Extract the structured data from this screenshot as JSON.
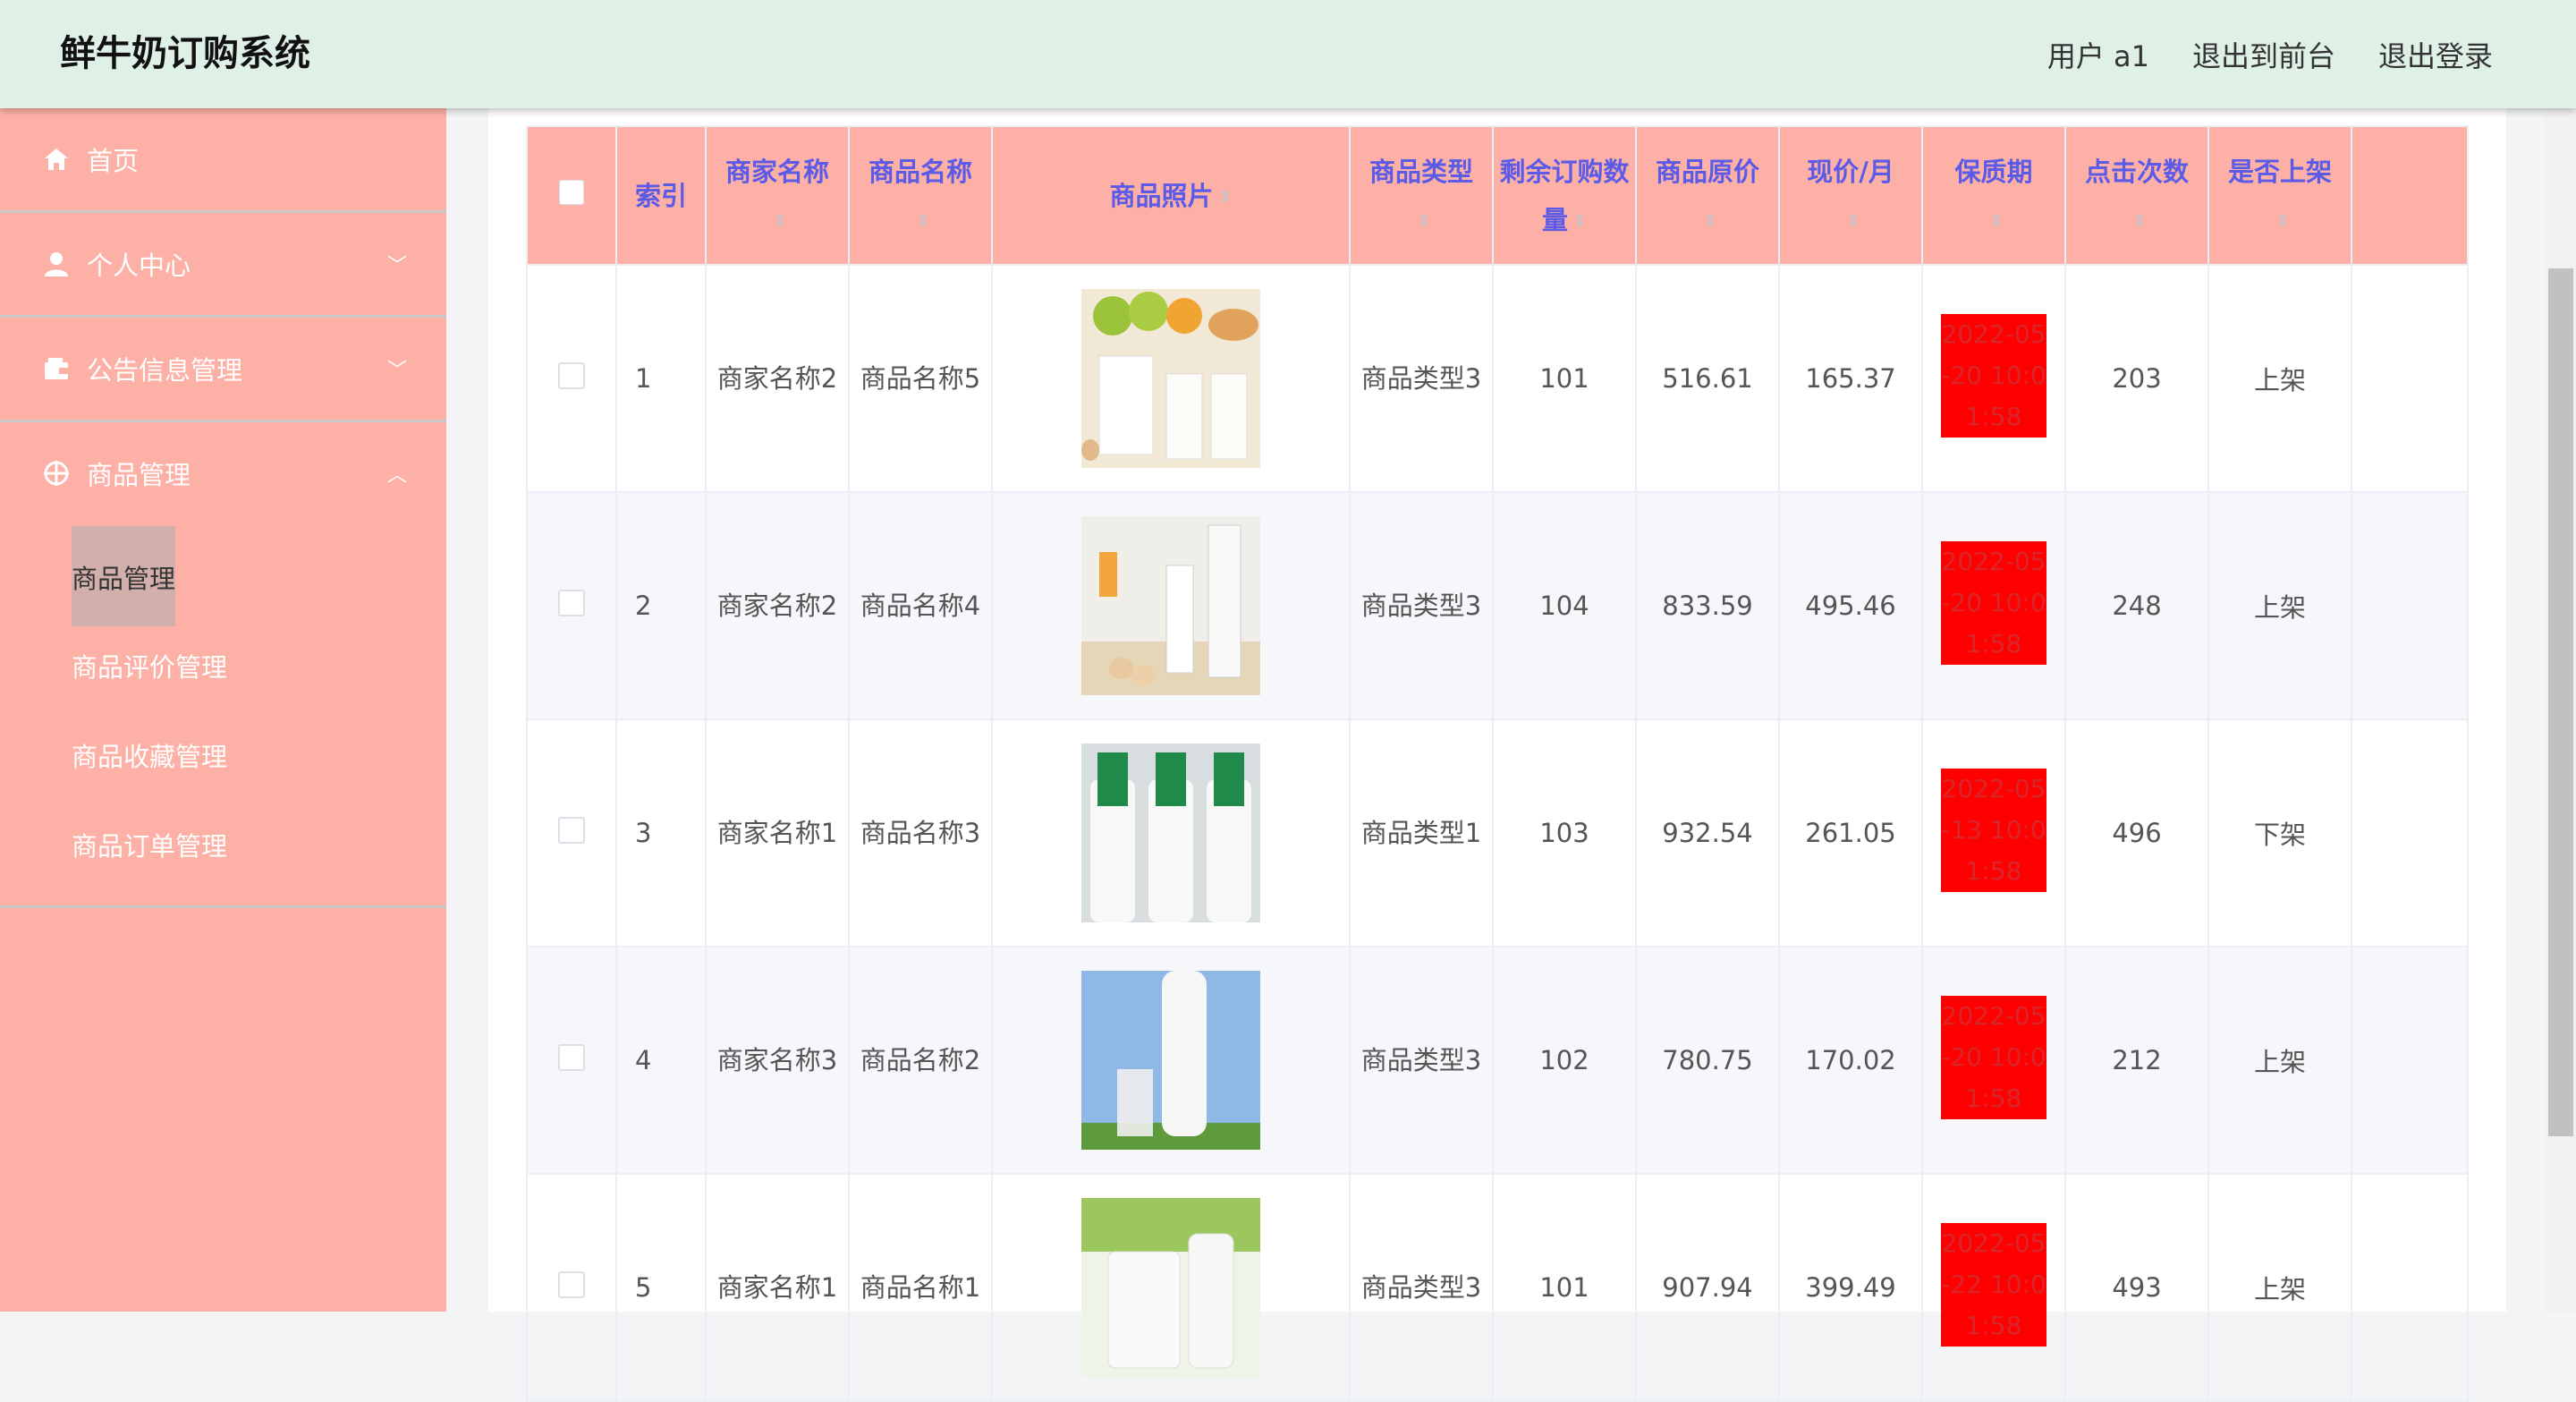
{
  "header": {
    "title": "鲜牛奶订购系统",
    "user_label": "用户 a1",
    "to_front_label": "退出到前台",
    "logout_label": "退出登录"
  },
  "sidebar": {
    "items": [
      {
        "label": "首页",
        "icon": "home-icon"
      },
      {
        "label": "个人中心",
        "icon": "user-icon",
        "arrow": "﹀"
      },
      {
        "label": "公告信息管理",
        "icon": "wallet-icon",
        "arrow": "﹀"
      },
      {
        "label": "商品管理",
        "icon": "target-icon",
        "arrow": "︿"
      }
    ],
    "subitems": [
      "商品管理",
      "商品评价管理",
      "商品收藏管理",
      "商品订单管理"
    ]
  },
  "table": {
    "headers": [
      "索引",
      "商家名称",
      "商品名称",
      "商品照片",
      "商品类型",
      "剩余订购数量",
      "商品原价",
      "现价/月",
      "保质期",
      "点击次数",
      "是否上架"
    ],
    "rows": [
      {
        "index": "1",
        "merchant": "商家名称2",
        "product": "商品名称5",
        "type": "商品类型3",
        "remaining": "101",
        "orig_price": "516.61",
        "price_month": "165.37",
        "expiry": "2022-05-20 10:01:58",
        "clicks": "203",
        "listed": "上架"
      },
      {
        "index": "2",
        "merchant": "商家名称2",
        "product": "商品名称4",
        "type": "商品类型3",
        "remaining": "104",
        "orig_price": "833.59",
        "price_month": "495.46",
        "expiry": "2022-05-20 10:01:58",
        "clicks": "248",
        "listed": "上架"
      },
      {
        "index": "3",
        "merchant": "商家名称1",
        "product": "商品名称3",
        "type": "商品类型1",
        "remaining": "103",
        "orig_price": "932.54",
        "price_month": "261.05",
        "expiry": "2022-05-13 10:01:58",
        "clicks": "496",
        "listed": "下架"
      },
      {
        "index": "4",
        "merchant": "商家名称3",
        "product": "商品名称2",
        "type": "商品类型3",
        "remaining": "102",
        "orig_price": "780.75",
        "price_month": "170.02",
        "expiry": "2022-05-20 10:01:58",
        "clicks": "212",
        "listed": "上架"
      },
      {
        "index": "5",
        "merchant": "商家名称1",
        "product": "商品名称1",
        "type": "商品类型3",
        "remaining": "101",
        "orig_price": "907.94",
        "price_month": "399.49",
        "expiry": "2022-05-22 10:01:58",
        "clicks": "493",
        "listed": "上架"
      }
    ]
  },
  "colors": {
    "header_bg": "#dff0e7",
    "sidebar_bg": "#fdb0a5",
    "table_header_bg": "#fdb0a5",
    "header_text": "#5b5be8",
    "expiry_bg": "#ff0000"
  }
}
